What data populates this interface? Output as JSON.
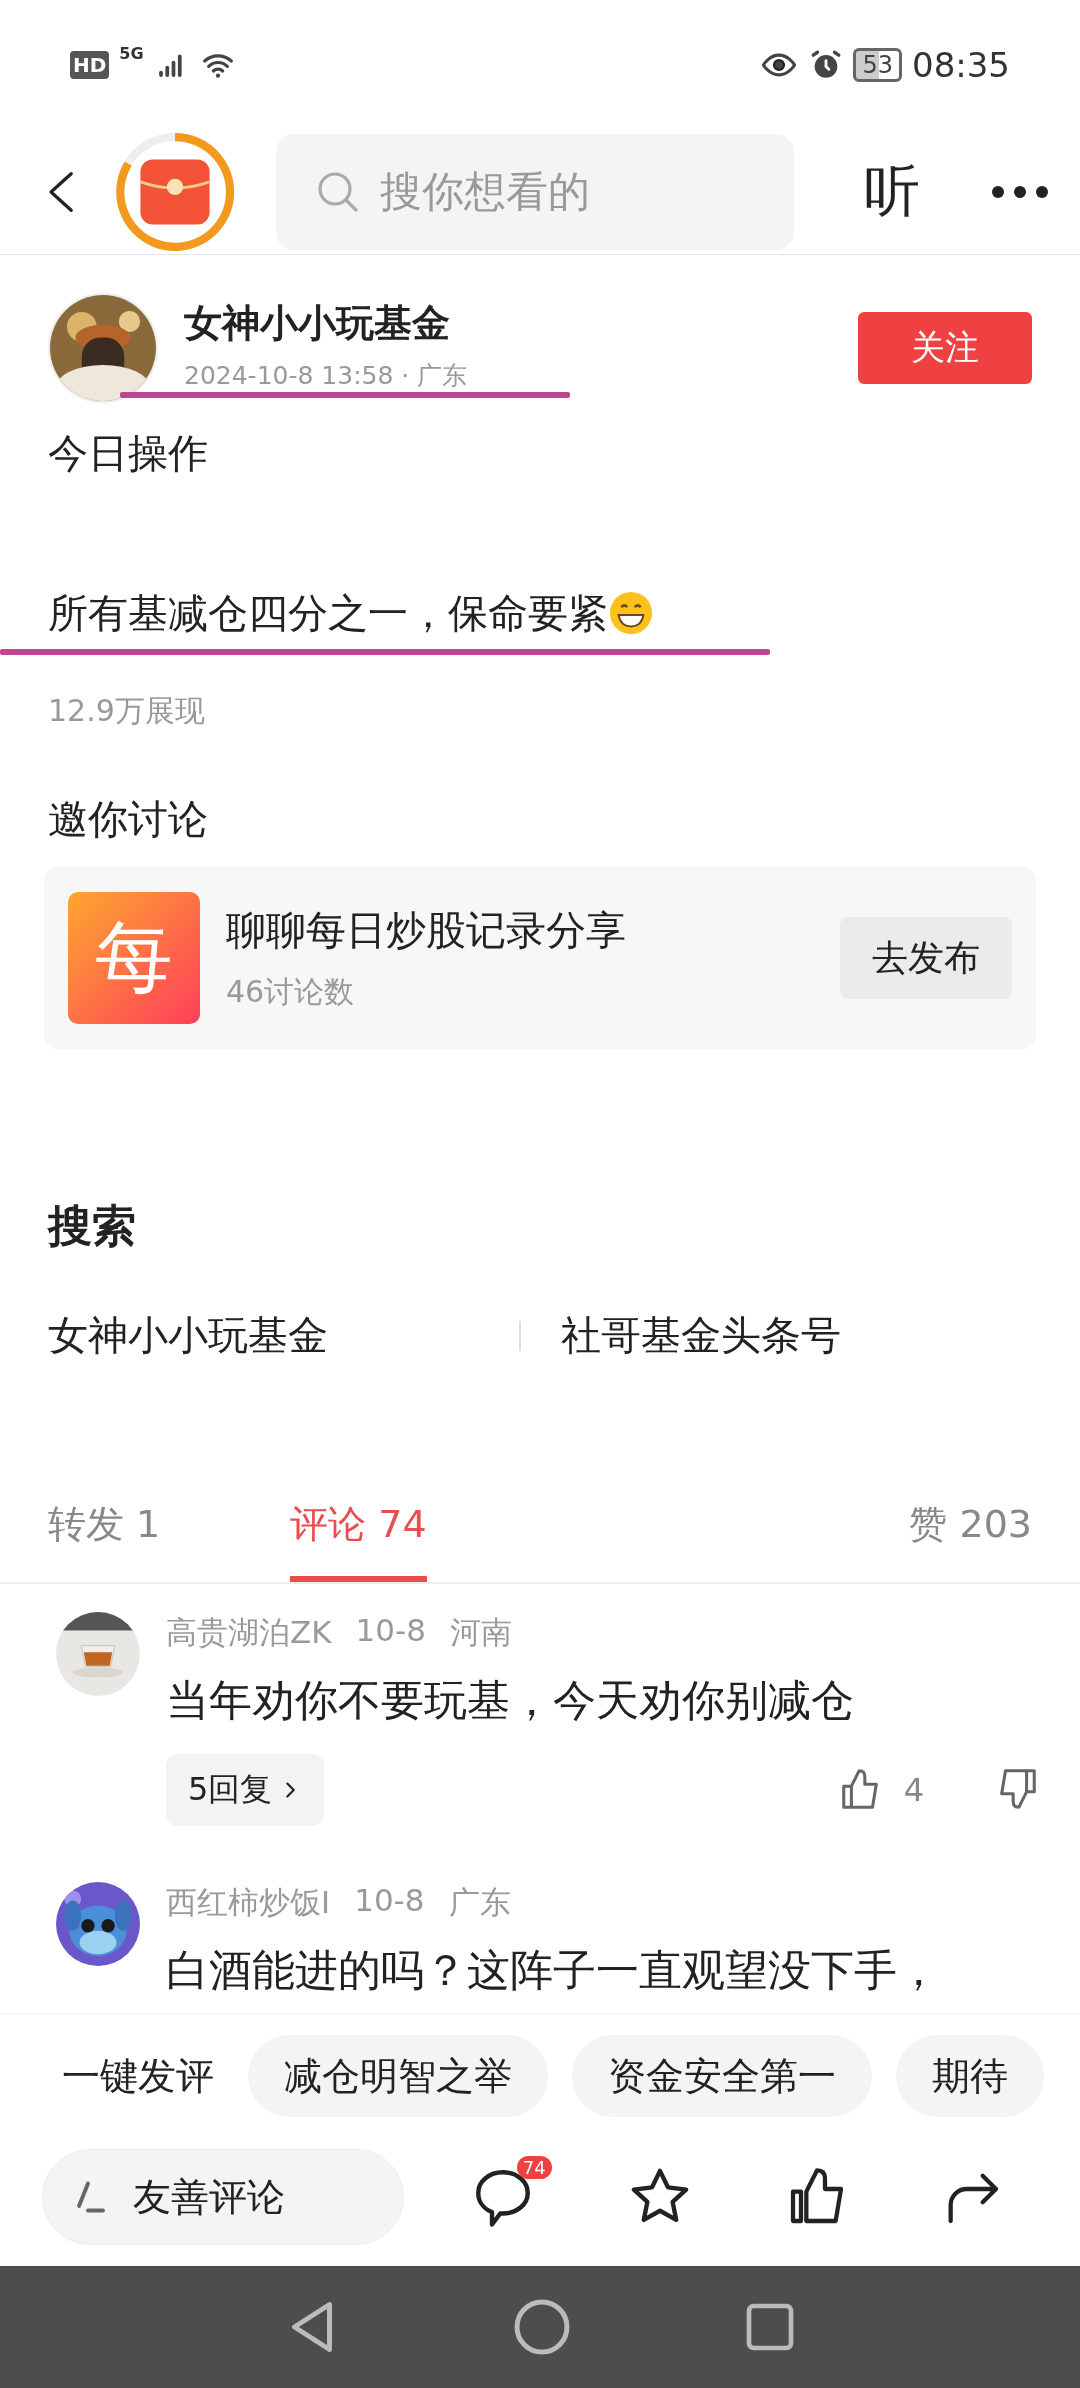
{
  "status_bar": {
    "hd_label": "HD",
    "network": "5G",
    "battery": "53",
    "time": "08:35"
  },
  "header": {
    "search_placeholder": "搜你想看的",
    "listen_label": "听"
  },
  "post": {
    "author": "女神小小玩基金",
    "meta": "2024-10-8 13:58 · 广东",
    "follow_label": "关注",
    "paragraphs": [
      "今日操作",
      "所有基减仓四分之一，保命要紧"
    ],
    "views": "12.9万展现"
  },
  "invite": {
    "heading": "邀你讨论",
    "topic": {
      "icon_char": "每",
      "title": "聊聊每日炒股记录分享",
      "count": "46讨论数",
      "action": "去发布"
    }
  },
  "search_section": {
    "heading": "搜索",
    "links": [
      "女神小小玩基金",
      "社哥基金头条号"
    ]
  },
  "tabs": [
    {
      "label": "转发 1",
      "selected": false
    },
    {
      "label": "评论 74",
      "selected": true
    },
    {
      "label": "赞 203",
      "selected": false
    }
  ],
  "comments": [
    {
      "user": "高贵湖泊ZK",
      "date": "10-8",
      "location": "河南",
      "text": "当年劝你不要玩基，今天劝你别减仓",
      "replies": "5回复",
      "likes": "4"
    },
    {
      "user": "西红柿炒饭I",
      "date": "10-8",
      "location": "广东",
      "text": "白酒能进的吗？这阵子一直观望没下手，"
    }
  ],
  "quick_replies": {
    "label": "一键发评",
    "chips": [
      "减仓明智之举",
      "资金安全第一",
      "期待"
    ]
  },
  "bottom_bar": {
    "placeholder": "友善评论",
    "comment_count": "74"
  }
}
